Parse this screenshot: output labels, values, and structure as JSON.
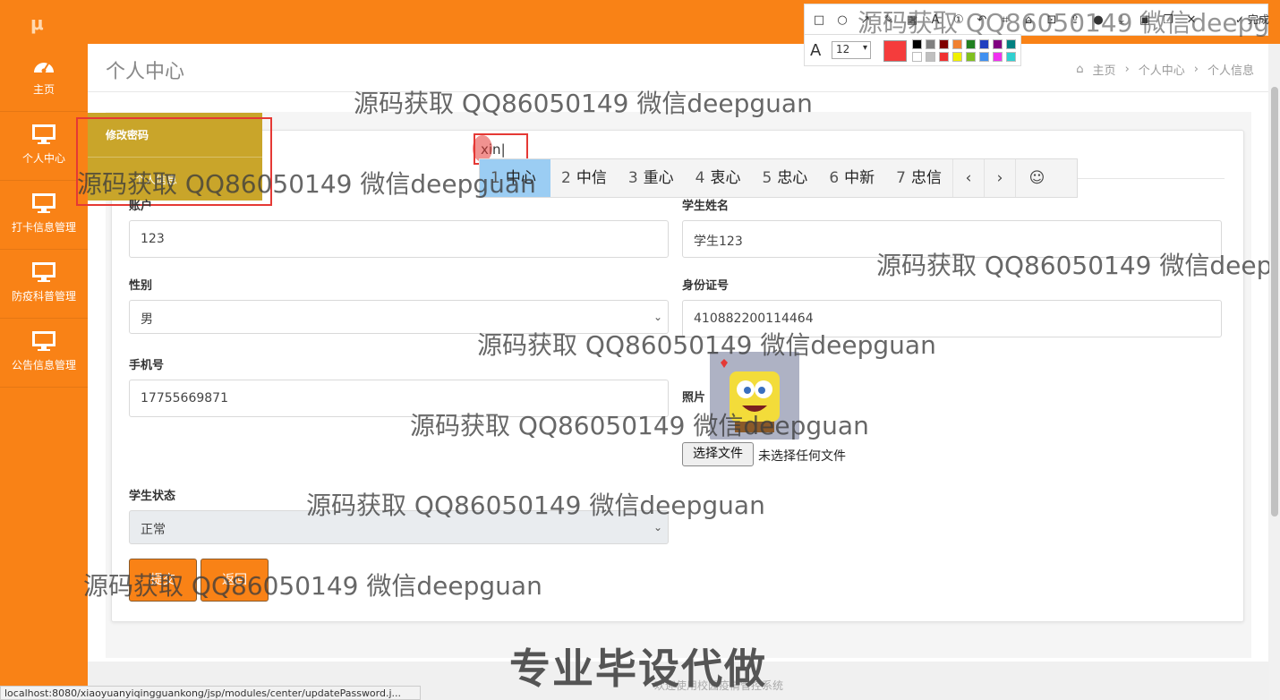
{
  "sidebar": {
    "items": [
      {
        "label": "主页",
        "icon": "dashboard-icon"
      },
      {
        "label": "个人中心",
        "icon": "monitor-icon"
      },
      {
        "label": "打卡信息管理",
        "icon": "monitor-icon"
      },
      {
        "label": "防疫科普管理",
        "icon": "monitor-icon"
      },
      {
        "label": "公告信息管理",
        "icon": "monitor-icon"
      }
    ]
  },
  "header": {
    "title": "个人中心",
    "breadcrumb": [
      "主页",
      "个人中心",
      "个人信息"
    ]
  },
  "tabs": {
    "change_password": "修改密码",
    "personal_info": "个人信息"
  },
  "form": {
    "account": {
      "label": "账户",
      "value": "123"
    },
    "student_name": {
      "label": "学生姓名",
      "value": "学生123"
    },
    "gender": {
      "label": "性别",
      "value": "男"
    },
    "id_number": {
      "label": "身份证号",
      "value": "410882200114464"
    },
    "phone": {
      "label": "手机号",
      "value": "17755669871"
    },
    "photo": {
      "label": "照片",
      "file_button": "选择文件",
      "file_status": "未选择任何文件"
    },
    "status": {
      "label": "学生状态",
      "value": "正常"
    },
    "submit_label": "提交",
    "back_label": "返回"
  },
  "ime": {
    "composition": "xin",
    "candidates": [
      {
        "n": "1",
        "text": "中心"
      },
      {
        "n": "2",
        "text": "中信"
      },
      {
        "n": "3",
        "text": "重心"
      },
      {
        "n": "4",
        "text": "衷心"
      },
      {
        "n": "5",
        "text": "忠心"
      },
      {
        "n": "6",
        "text": "中新"
      },
      {
        "n": "7",
        "text": "忠信"
      }
    ],
    "prev": "‹",
    "next": "›",
    "emoji": "☺"
  },
  "screenshot_tool": {
    "done_label": "完成",
    "font_size": "12",
    "current_color": "#f53c3c",
    "palette": [
      "#000000",
      "#808080",
      "#800000",
      "#f08030",
      "#208020",
      "#2040c0",
      "#800080",
      "#008080",
      "#ffffff",
      "#c0c0c0",
      "#f03030",
      "#f0f000",
      "#80c020",
      "#4090f0",
      "#f030f0",
      "#30d0d0"
    ]
  },
  "watermarks": {
    "text": "源码获取 QQ86050149 微信deepguan",
    "banner": "专业毕设代做"
  },
  "footer": "欢迎使用校园疫情管控系统",
  "status_url": "localhost:8080/xiaoyuanyiqingguankong/jsp/modules/center/updatePassword.j...",
  "colors": {
    "brand": "#f98216",
    "tab_active": "#c9a52a"
  }
}
